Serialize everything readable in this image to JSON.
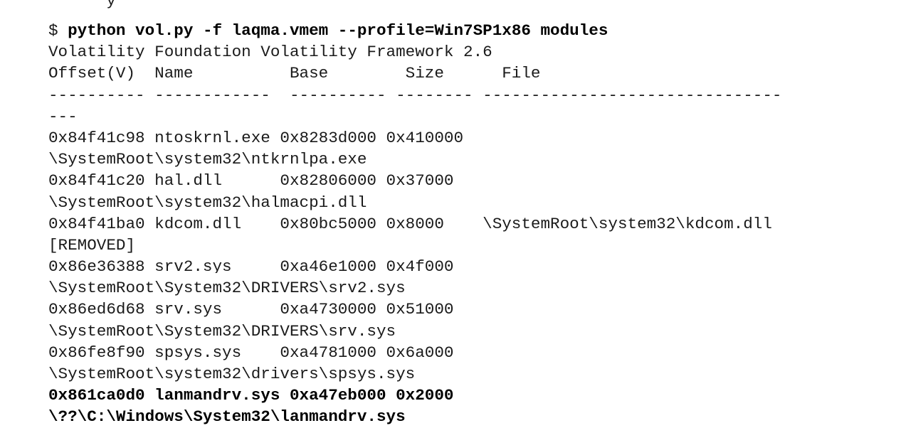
{
  "partial_top_line": "      y",
  "command": {
    "prompt": "$ ",
    "text": "python vol.py -f laqma.vmem --profile=Win7SP1x86 modules"
  },
  "banner": "Volatility Foundation Volatility Framework 2.6",
  "header": "Offset(V)  Name          Base        Size      File",
  "separator_1": "---------- ------------  ---------- -------- -------------------------------",
  "separator_2": "---",
  "rows": [
    {
      "text": "0x84f41c98 ntoskrnl.exe 0x8283d000 0x410000"
    },
    {
      "text": "\\SystemRoot\\system32\\ntkrnlpa.exe"
    },
    {
      "text": "0x84f41c20 hal.dll      0x82806000 0x37000"
    },
    {
      "text": "\\SystemRoot\\system32\\halmacpi.dll"
    },
    {
      "text": "0x84f41ba0 kdcom.dll    0x80bc5000 0x8000    \\SystemRoot\\system32\\kdcom.dll"
    },
    {
      "text": "[REMOVED]"
    },
    {
      "text": "0x86e36388 srv2.sys     0xa46e1000 0x4f000"
    },
    {
      "text": "\\SystemRoot\\System32\\DRIVERS\\srv2.sys"
    },
    {
      "text": "0x86ed6d68 srv.sys      0xa4730000 0x51000"
    },
    {
      "text": "\\SystemRoot\\System32\\DRIVERS\\srv.sys"
    },
    {
      "text": "0x86fe8f90 spsys.sys    0xa4781000 0x6a000"
    },
    {
      "text": "\\SystemRoot\\system32\\drivers\\spsys.sys"
    },
    {
      "text": "0x861ca0d0 lanmandrv.sys 0xa47eb000 0x2000"
    },
    {
      "text": "\\??\\C:\\Windows\\System32\\lanmandrv.sys"
    }
  ]
}
